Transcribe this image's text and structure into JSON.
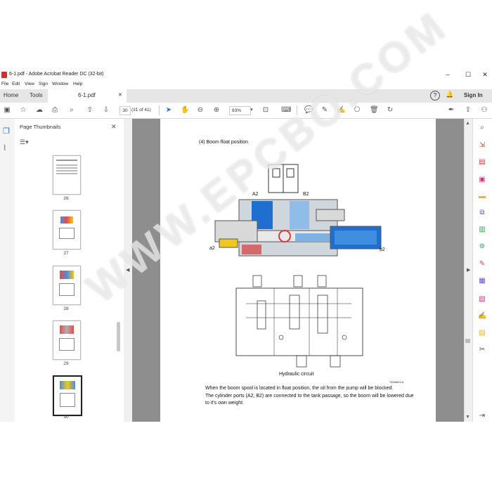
{
  "window": {
    "title": "6-1.pdf - Adobe Acrobat Reader DC (32-bit)",
    "minimize": "–",
    "maximize": "☐",
    "close": "✕"
  },
  "menu": [
    "File",
    "Edit",
    "View",
    "Sign",
    "Window",
    "Help"
  ],
  "tabs": {
    "home": "Home",
    "tools": "Tools",
    "document": "6-1.pdf",
    "document_close": "✕",
    "help": "?",
    "notifications": "🔔",
    "sign_in": "Sign In"
  },
  "toolbar": {
    "page_number": "30",
    "page_count": "(31 of 41)",
    "zoom": "83%"
  },
  "thumbnails": {
    "title": "Page Thumbnails",
    "close": "✕",
    "pages": [
      "26",
      "27",
      "28",
      "29",
      "30"
    ],
    "selected": "30"
  },
  "document": {
    "section_title": "(4) Boom float position",
    "port_a2": "A2",
    "port_b2": "B2",
    "label_a2": "a2",
    "label_b2": "b2",
    "circuit_caption": "Hydraulic circuit",
    "figure_code": "7808MECA",
    "paragraph_1": "When the boom spool is located in float position, the oil from the pump will be blocked.",
    "paragraph_2": "The cylinder ports (A2, B2) are connected to the tank passage, so the boom will be lowered due",
    "paragraph_3": "to it's own weight."
  },
  "watermark": "WWW.EPCBO.COM",
  "colors": {
    "acrobat_red": "#d32f2f",
    "accent_blue": "#1473e6",
    "valve_blue": "#1f6fd1",
    "valve_yellow": "#f2c81a",
    "valve_red": "#d93b3b"
  }
}
